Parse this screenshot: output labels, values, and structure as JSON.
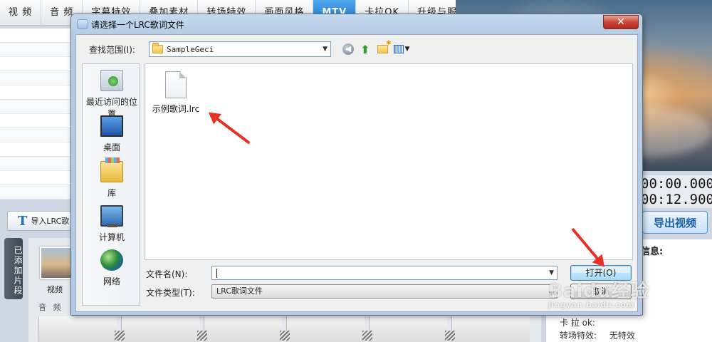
{
  "app": {
    "tabs": [
      "视 频",
      "音 频",
      "字幕特效",
      "叠加素材",
      "转场特效",
      "画面风格",
      "MTV",
      "卡拉OK",
      "升级与服务"
    ],
    "active_tab_index": 6,
    "timecode_top": "00:00.000",
    "timecode_bottom": "00:12.900",
    "import_button_label": "导入LRC歌",
    "export_button_label": "导出视频",
    "added_clips_tab_label": "已添加片段",
    "clip_label": "视频",
    "track_label": "音 频",
    "info_title_label": "信息:",
    "info_rows": [
      {
        "label": "卡 拉 ok:",
        "value": ""
      },
      {
        "label": "转场特效:",
        "value": "无特效"
      }
    ]
  },
  "dialog": {
    "title": "请选择一个LRC歌词文件",
    "close_label": "✕",
    "look_in_label": "查找范围(I):",
    "look_in_value": "SampleGeci",
    "places": [
      {
        "label": "最近访问的位置",
        "icon": "recent-places-icon"
      },
      {
        "label": "桌面",
        "icon": "desktop-icon"
      },
      {
        "label": "库",
        "icon": "library-icon"
      },
      {
        "label": "计算机",
        "icon": "computer-icon"
      },
      {
        "label": "网络",
        "icon": "network-icon"
      }
    ],
    "files": [
      {
        "name": "示例歌词.lrc",
        "icon": "lrc-file-icon"
      }
    ],
    "file_name_label": "文件名(N):",
    "file_name_value": "",
    "file_type_label": "文件类型(T):",
    "file_type_value": "LRC歌词文件",
    "open_button_label": "打开(O)",
    "cancel_button_label": "取消"
  },
  "watermark": {
    "line1": "Baidu经验",
    "line2": "jingyan.baidu.com"
  },
  "colors": {
    "active_tab": "#1c74c8",
    "annotation_arrow": "#e63124",
    "dialog_frame": "#b3cbe4"
  }
}
